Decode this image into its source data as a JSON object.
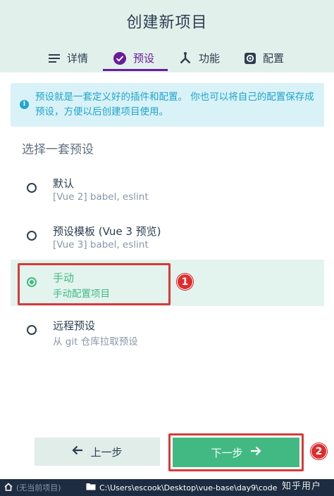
{
  "header": {
    "title": "创建新项目",
    "tabs": [
      {
        "label": "详情",
        "icon": "list-icon"
      },
      {
        "label": "预设",
        "icon": "check-circle-icon",
        "active": true
      },
      {
        "label": "功能",
        "icon": "fork-icon"
      },
      {
        "label": "配置",
        "icon": "gear-icon"
      }
    ]
  },
  "info": {
    "text": "预设就是一套定义好的插件和配置。 你也可以将自己的配置保存成预设，方便以后创建项目使用。"
  },
  "presets": {
    "section_title": "选择一套预设",
    "items": [
      {
        "name": "默认",
        "description": "[Vue 2] babel, eslint",
        "selected": false
      },
      {
        "name": "预设模板 (Vue 3 预览)",
        "description": "[Vue 3] babel, eslint",
        "selected": false
      },
      {
        "name": "手动",
        "description": "手动配置项目",
        "selected": true
      },
      {
        "name": "远程预设",
        "description": "从 git 仓库拉取预设",
        "selected": false
      }
    ]
  },
  "footer": {
    "prev_label": "上一步",
    "next_label": "下一步"
  },
  "annotations": {
    "marker_1": "1",
    "marker_2": "2"
  },
  "statusbar": {
    "project": "(无当前项目)",
    "path": "C:\\Users\\escook\\Desktop\\vue-base\\day9\\code"
  },
  "watermark": "知乎用户",
  "colors": {
    "accent_green": "#42b983",
    "tab_active_purple": "#6a1b9a",
    "info_blue": "#1ea6cf",
    "highlight_red": "#d63a3a",
    "statusbar_bg": "#1d2c40"
  }
}
